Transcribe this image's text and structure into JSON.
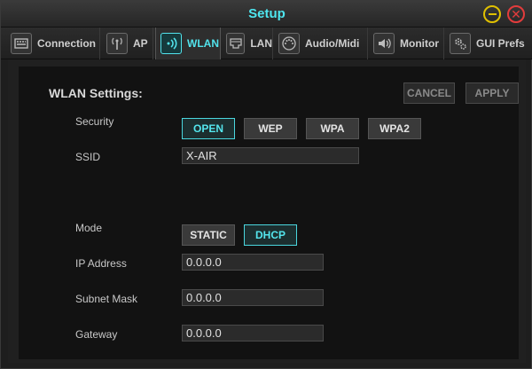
{
  "window": {
    "title": "Setup",
    "accent_color": "#4ee6ef",
    "minimize_icon": "minimize-icon",
    "close_icon": "close-icon",
    "close_glyph": "✕"
  },
  "tabs": [
    {
      "label": "Connection",
      "icon": "connection-icon",
      "active": false
    },
    {
      "label": "AP",
      "icon": "antenna-icon",
      "active": false
    },
    {
      "label": "WLAN",
      "icon": "wifi-icon",
      "active": true
    },
    {
      "label": "LAN",
      "icon": "ethernet-port-icon",
      "active": false
    },
    {
      "label": "Audio/Midi",
      "icon": "midi-connector-icon",
      "active": false
    },
    {
      "label": "Monitor",
      "icon": "speaker-icon",
      "active": false
    },
    {
      "label": "GUI Prefs",
      "icon": "gears-icon",
      "active": false
    }
  ],
  "wlan": {
    "title": "WLAN Settings:",
    "cancel_label": "CANCEL",
    "apply_label": "APPLY",
    "security": {
      "label": "Security",
      "options": [
        "OPEN",
        "WEP",
        "WPA",
        "WPA2"
      ],
      "selected": "OPEN"
    },
    "ssid": {
      "label": "SSID",
      "value": "X-AIR"
    },
    "mode": {
      "label": "Mode",
      "options": [
        "STATIC",
        "DHCP"
      ],
      "selected": "DHCP"
    },
    "ip_address": {
      "label": "IP Address",
      "value": "0.0.0.0"
    },
    "subnet_mask": {
      "label": "Subnet Mask",
      "value": "0.0.0.0"
    },
    "gateway": {
      "label": "Gateway",
      "value": "0.0.0.0"
    }
  }
}
